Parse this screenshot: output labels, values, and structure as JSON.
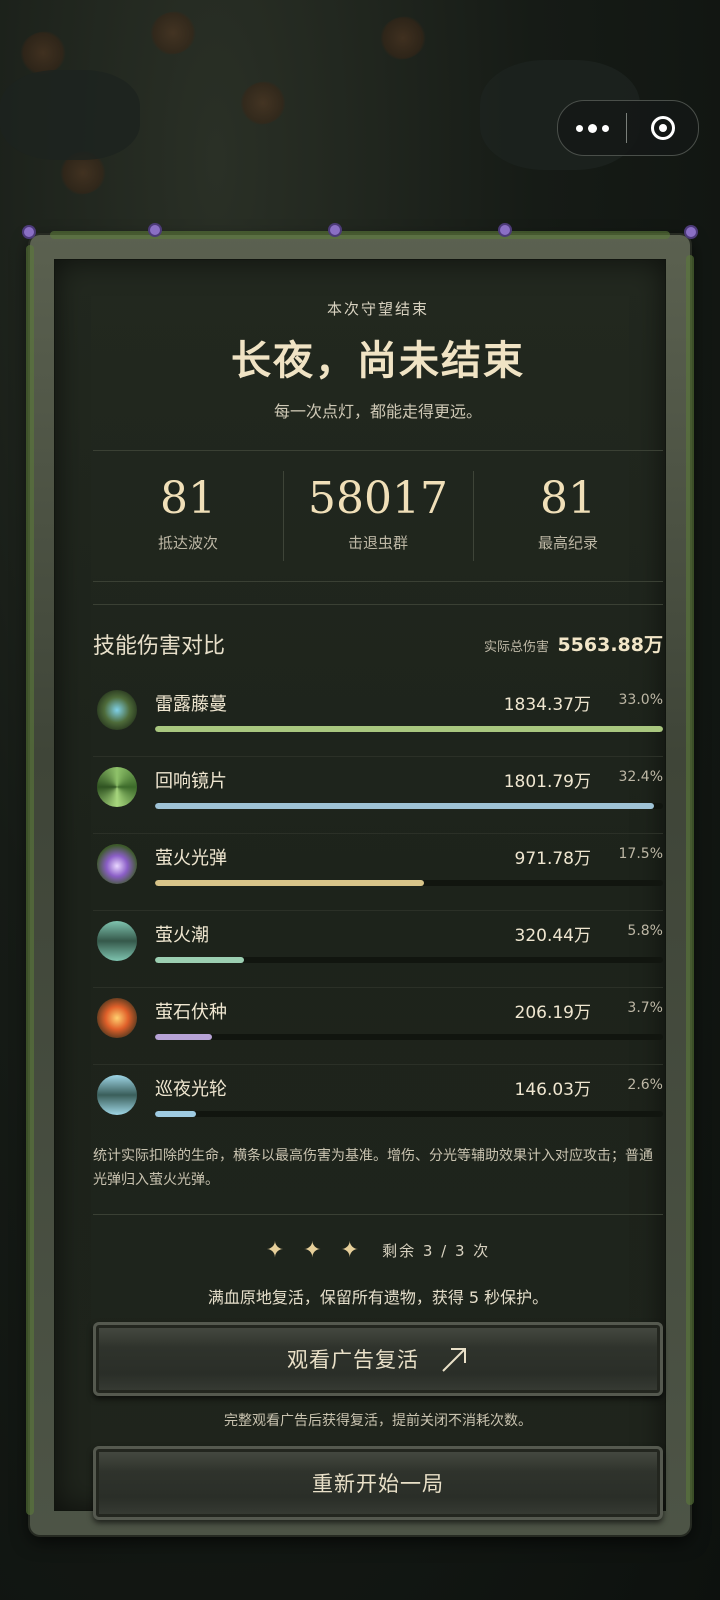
{
  "header": {
    "subtitle": "本次守望结束",
    "title": "长夜，尚未结束",
    "tagline": "每一次点灯，都能走得更远。"
  },
  "stats": [
    {
      "value": "81",
      "label": "抵达波次"
    },
    {
      "value": "58017",
      "label": "击退虫群"
    },
    {
      "value": "81",
      "label": "最高纪录"
    }
  ],
  "damage": {
    "title": "技能伤害对比",
    "total_label": "实际总伤害",
    "total_value": "5563.88万",
    "skills": [
      {
        "name": "雷露藤蔓",
        "value": "1834.37万",
        "percent": "33.0%",
        "fill": 1.0,
        "color": "#a9c77f",
        "icon": "lightning-vine-icon"
      },
      {
        "name": "回响镜片",
        "value": "1801.79万",
        "percent": "32.4%",
        "fill": 0.982,
        "color": "#9fc3d6",
        "icon": "echo-swirl-icon"
      },
      {
        "name": "萤火光弹",
        "value": "971.78万",
        "percent": "17.5%",
        "fill": 0.53,
        "color": "#d8c489",
        "icon": "firefly-orb-icon"
      },
      {
        "name": "萤火潮",
        "value": "320.44万",
        "percent": "5.8%",
        "fill": 0.175,
        "color": "#9ccfb2",
        "icon": "tide-totem-icon"
      },
      {
        "name": "萤石伏种",
        "value": "206.19万",
        "percent": "3.7%",
        "fill": 0.112,
        "color": "#b7a3d6",
        "icon": "seed-bomb-icon"
      },
      {
        "name": "巡夜光轮",
        "value": "146.03万",
        "percent": "2.6%",
        "fill": 0.08,
        "color": "#9ecbe2",
        "icon": "night-wheel-icon"
      }
    ]
  },
  "note": "统计实际扣除的生命，横条以最高伤害为基准。增伤、分光等辅助效果计入对应攻击；普通光弹归入萤火光弹。",
  "revive": {
    "stars": "✦ ✦ ✦",
    "remaining": "剩余 3 / 3 次",
    "description": "满血原地复活，保留所有遗物，获得 5 秒保护。",
    "ad_button": "观看广告复活",
    "ad_note": "完整观看广告后获得复活，提前关闭不消耗次数。",
    "restart_button": "重新开始一局"
  }
}
